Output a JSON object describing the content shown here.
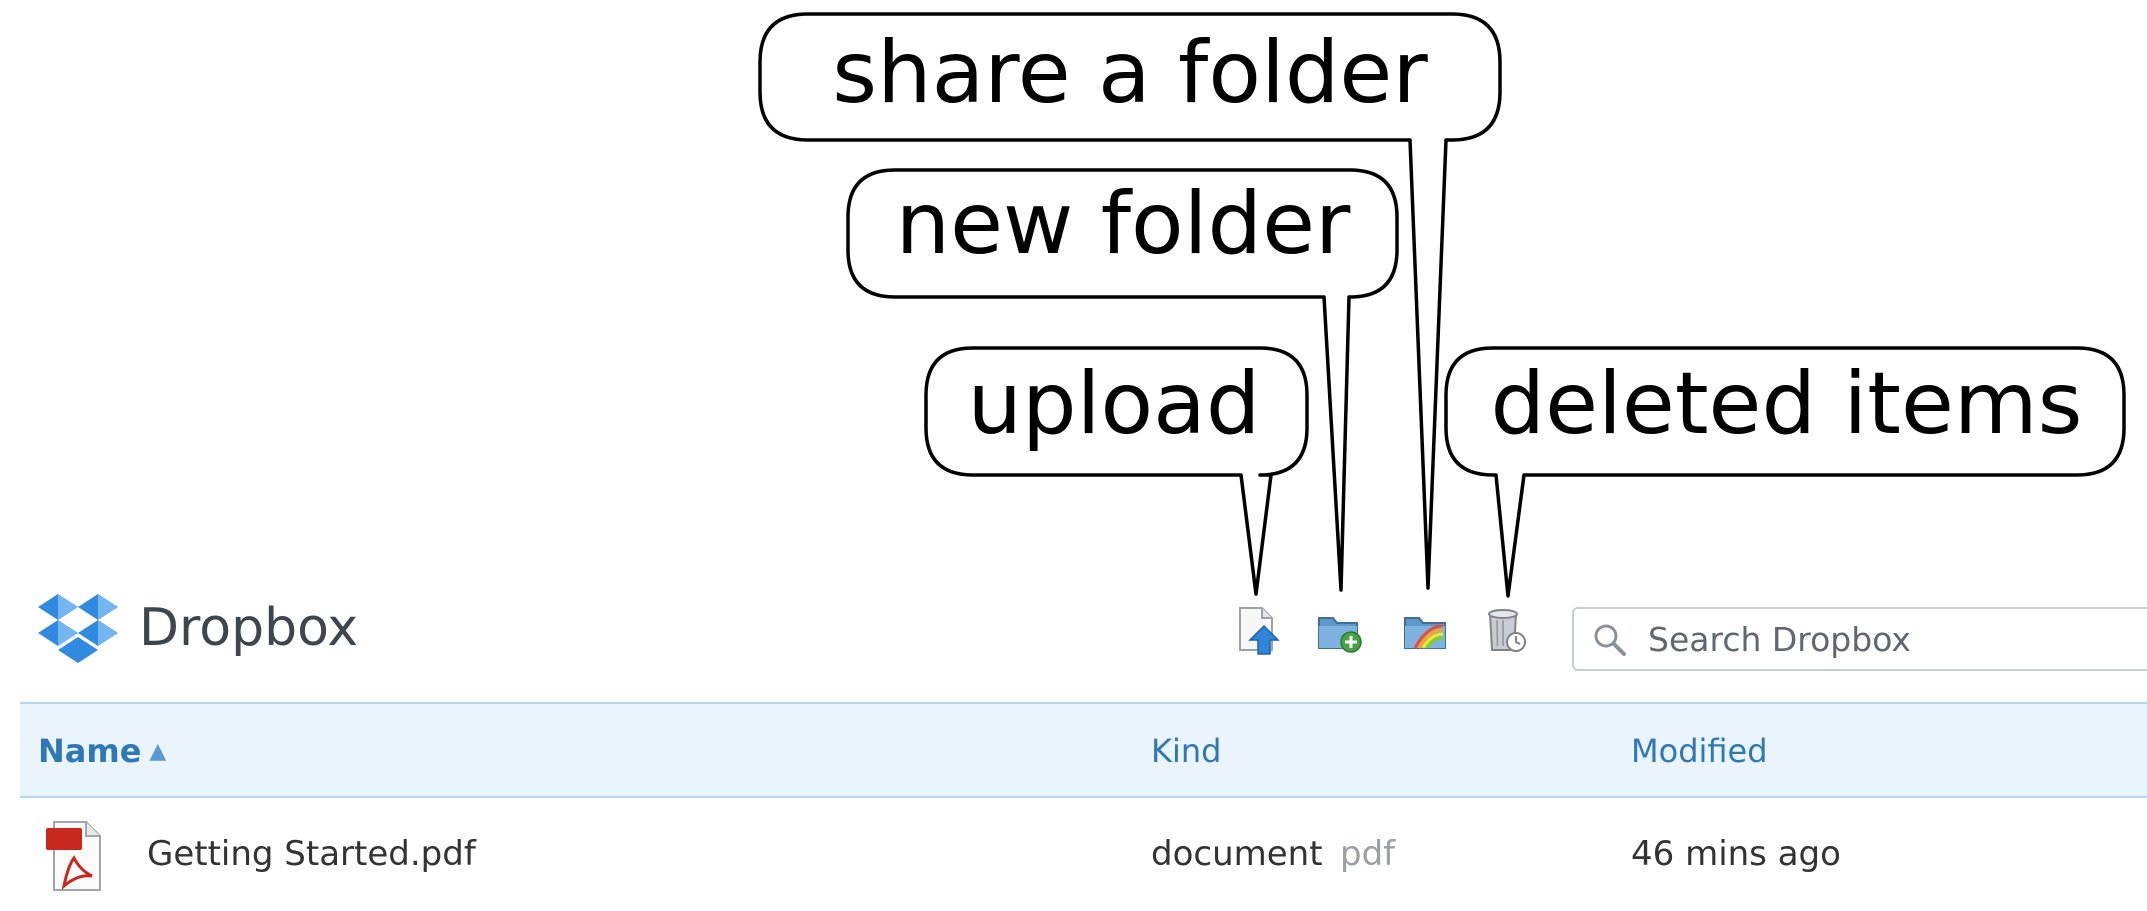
{
  "annotations": {
    "share_a_folder": "share a folder",
    "new_folder": "new folder",
    "upload": "upload",
    "deleted_items": "deleted items"
  },
  "header": {
    "logo_icon": "dropbox-logo-icon",
    "brand": "Dropbox"
  },
  "toolbar": {
    "icons": [
      "upload-icon",
      "new-folder-icon",
      "share-folder-icon",
      "deleted-items-icon"
    ]
  },
  "search": {
    "placeholder": "Search Dropbox",
    "value": ""
  },
  "table": {
    "columns": {
      "name": "Name",
      "kind": "Kind",
      "modified": "Modified"
    },
    "sort_indicator": "▲",
    "rows": [
      {
        "icon": "pdf-file-icon",
        "name": "Getting Started.pdf",
        "kind": "document",
        "extension": "pdf",
        "modified": "46 mins ago"
      }
    ]
  },
  "colors": {
    "brand_text": "#3d464d",
    "header_bg": "#eaf4fc",
    "header_border": "#b5d7f0",
    "link_blue": "#3077b5",
    "dropbox_blue": "#2f8ae0",
    "pdf_red": "#c8281e"
  }
}
